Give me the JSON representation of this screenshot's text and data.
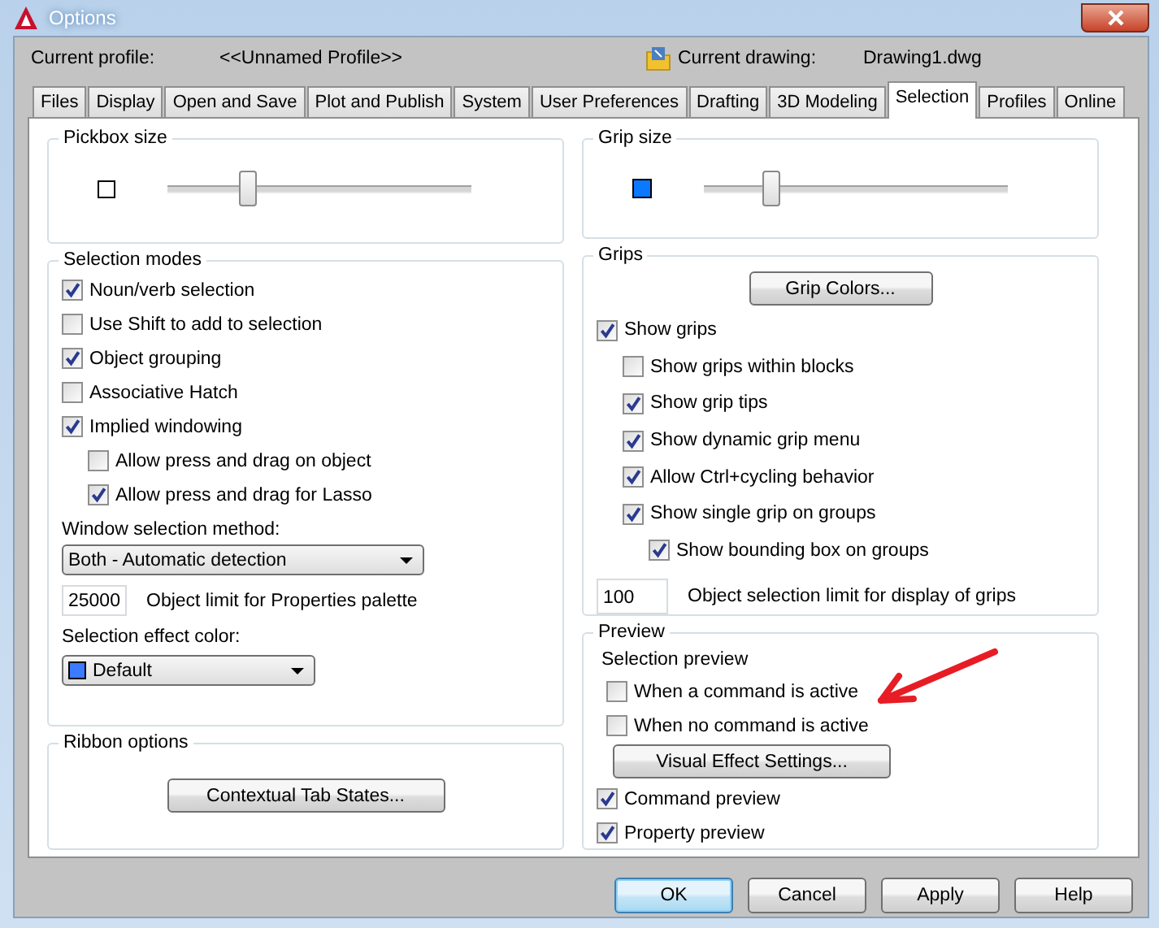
{
  "window": {
    "title": "Options"
  },
  "header": {
    "profile_label": "Current profile:",
    "profile": "<<Unnamed Profile>>",
    "drawing_label": "Current drawing:",
    "drawing": "Drawing1.dwg"
  },
  "tabs": [
    {
      "label": "Files",
      "selected": false
    },
    {
      "label": "Display",
      "selected": false
    },
    {
      "label": "Open and Save",
      "selected": false
    },
    {
      "label": "Plot and Publish",
      "selected": false
    },
    {
      "label": "System",
      "selected": false
    },
    {
      "label": "User Preferences",
      "selected": false
    },
    {
      "label": "Drafting",
      "selected": false
    },
    {
      "label": "3D Modeling",
      "selected": false
    },
    {
      "label": "Selection",
      "selected": true
    },
    {
      "label": "Profiles",
      "selected": false
    },
    {
      "label": "Online",
      "selected": false
    }
  ],
  "pickbox": {
    "title": "Pickbox size",
    "level": 0.26
  },
  "selection_modes": {
    "title": "Selection modes",
    "options": [
      {
        "label": "Noun/verb selection",
        "checked": true
      },
      {
        "label": "Use Shift to add to selection",
        "checked": false
      },
      {
        "label": "Object grouping",
        "checked": true
      },
      {
        "label": "Associative Hatch",
        "checked": false
      },
      {
        "label": "Implied windowing",
        "checked": true,
        "children": [
          {
            "label": "Allow press and drag on object",
            "checked": false
          },
          {
            "label": "Allow press and drag for Lasso",
            "checked": true
          }
        ]
      }
    ],
    "window_method_label": "Window selection method:",
    "window_method": "Both - Automatic detection",
    "object_limit": "25000",
    "object_limit_label": "Object limit for Properties palette",
    "effect_color_label": "Selection effect color:",
    "effect_color": "Default"
  },
  "ribbon": {
    "title": "Ribbon options",
    "button": "Contextual Tab States..."
  },
  "grip_size": {
    "title": "Grip size",
    "level": 0.22
  },
  "grips": {
    "title": "Grips",
    "button": "Grip Colors...",
    "options": [
      {
        "label": "Show grips",
        "checked": true,
        "children": [
          {
            "label": "Show grips within blocks",
            "checked": false
          },
          {
            "label": "Show grip tips",
            "checked": true
          },
          {
            "label": "Show dynamic grip menu",
            "checked": true
          },
          {
            "label": "Allow Ctrl+cycling behavior",
            "checked": true
          },
          {
            "label": "Show single grip on groups",
            "checked": true,
            "children": [
              {
                "label": "Show bounding box on groups",
                "checked": true
              }
            ]
          }
        ]
      }
    ],
    "limit": "100",
    "limit_label": "Object selection limit for display of grips"
  },
  "preview": {
    "title": "Preview",
    "subtitle": "Selection preview",
    "selection_options": [
      {
        "label": "When a command is active",
        "checked": false
      },
      {
        "label": "When no command is active",
        "checked": false
      }
    ],
    "button": "Visual Effect Settings...",
    "options": [
      {
        "label": "Command preview",
        "checked": true
      },
      {
        "label": "Property preview",
        "checked": true
      }
    ]
  },
  "buttons": [
    {
      "label": "OK",
      "default": true
    },
    {
      "label": "Cancel",
      "default": false
    },
    {
      "label": "Apply",
      "default": false
    },
    {
      "label": "Help",
      "default": false
    }
  ]
}
